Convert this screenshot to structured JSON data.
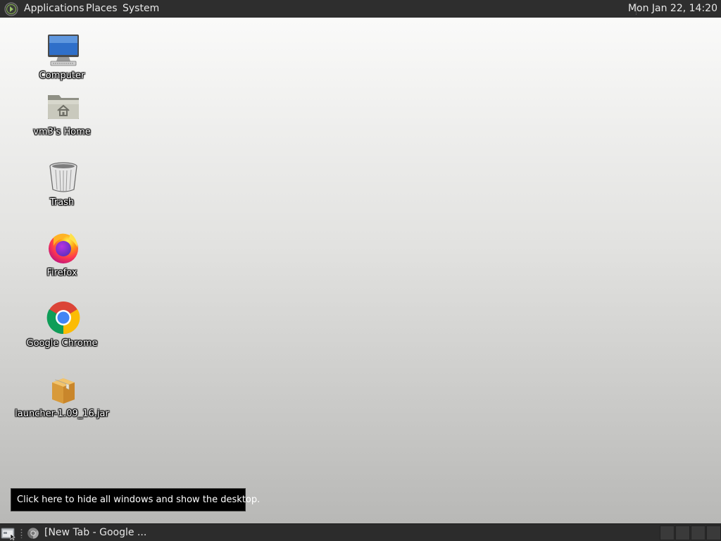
{
  "top_panel": {
    "menus": [
      "Applications",
      "Places",
      "System"
    ],
    "clock": "Mon Jan 22, 14:20"
  },
  "desktop": {
    "icons": [
      {
        "label": "Computer",
        "icon": "computer-icon"
      },
      {
        "label": "vm3's Home",
        "icon": "home-folder-icon"
      },
      {
        "label": "Trash",
        "icon": "trash-icon"
      },
      {
        "label": "Firefox",
        "icon": "firefox-icon"
      },
      {
        "label": "Google Chrome",
        "icon": "chrome-icon"
      },
      {
        "label": "launcher-1.09_16.jar",
        "icon": "jar-package-icon"
      }
    ]
  },
  "tooltip": {
    "text": "Click here to hide all windows and show the desktop."
  },
  "bottom_panel": {
    "show_desktop_icon": "show-desktop-icon",
    "tasks": [
      {
        "label": "[New Tab - Google ...",
        "icon": "chrome-icon"
      }
    ],
    "workspaces": 4
  },
  "colors": {
    "panel_bg": "#2e2e2e",
    "panel_text": "#e8e8e8",
    "tooltip_bg": "#000000",
    "desktop_top": "#fafaf9",
    "desktop_bottom": "#b8b8b6"
  }
}
